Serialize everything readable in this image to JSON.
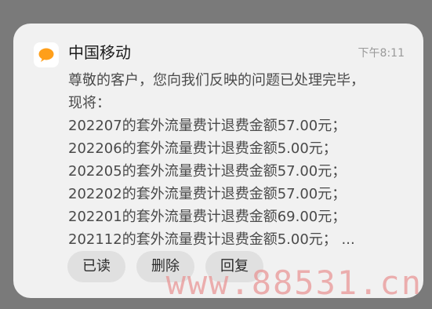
{
  "notification": {
    "app_name": "中国移动",
    "icon": "chat-bubble-icon",
    "time": "下午8:11",
    "lines": [
      "尊敬的客户，您向我们反映的问题已处理完毕，",
      "现将：",
      "202207的套外流量费计退费金额57.00元；",
      "202206的套外流量费计退费金额5.00元；",
      "202205的套外流量费计退费金额57.00元；",
      "202202的套外流量费计退费金额57.00元；",
      "202201的套外流量费计退费金额69.00元；",
      "202112的套外流量费计退费金额5.00元； ..."
    ],
    "actions": {
      "read": "已读",
      "delete": "删除",
      "reply": "回复"
    }
  },
  "watermark": "www.88531.cn",
  "colors": {
    "background": "#7a7a7a",
    "card": "#f1f1f1",
    "icon_bubble": "#ff9f1a",
    "button": "#e0e0e0",
    "watermark": "#e89696"
  }
}
